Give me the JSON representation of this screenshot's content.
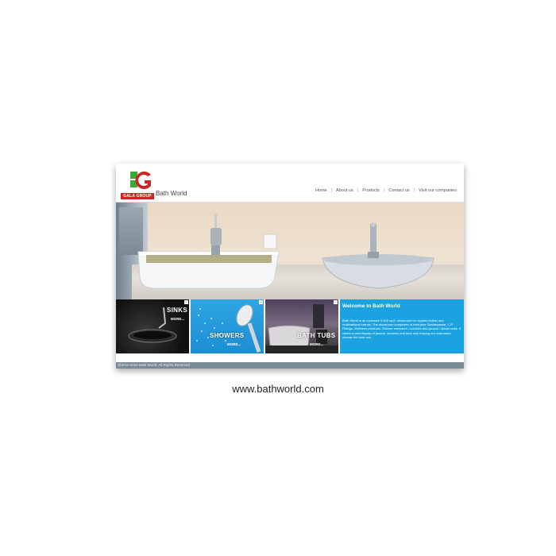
{
  "header": {
    "logo_text": "GALA GROUP",
    "brand": "Bath World",
    "nav": [
      "Home",
      "About us",
      "Products",
      "Contact us",
      "Visit our companies"
    ],
    "nav_separator": "|"
  },
  "tiles": [
    {
      "label": "SINKS",
      "more": "MORE..."
    },
    {
      "label": "SHOWERS",
      "more": "MORE..."
    },
    {
      "label": "BATH TUBS",
      "more": "MORE..."
    }
  ],
  "welcome": {
    "title": "Welcome to Bath World",
    "body": "Bath World is an exclusive 5,000 sq.ft. showroom for reputed Indian and multinational brands. The showroom comprises of exclusive Sanitaryware, C.P. Fittings, Wellness products, Shower enclosure / cubicles and jacuzzi / steam units. It caters a vast display of jacuzzi, showers and tubs only helping our customers choose the best one."
  },
  "footer": {
    "copyright": "@2011-2012 Bath World. All Rights Reserved"
  },
  "caption": {
    "url": "www.bathworld.com"
  },
  "colors": {
    "accent_blue": "#1aa3e0",
    "logo_red": "#d02424",
    "logo_green": "#3aa935",
    "footer_gray": "#7a8a95"
  }
}
